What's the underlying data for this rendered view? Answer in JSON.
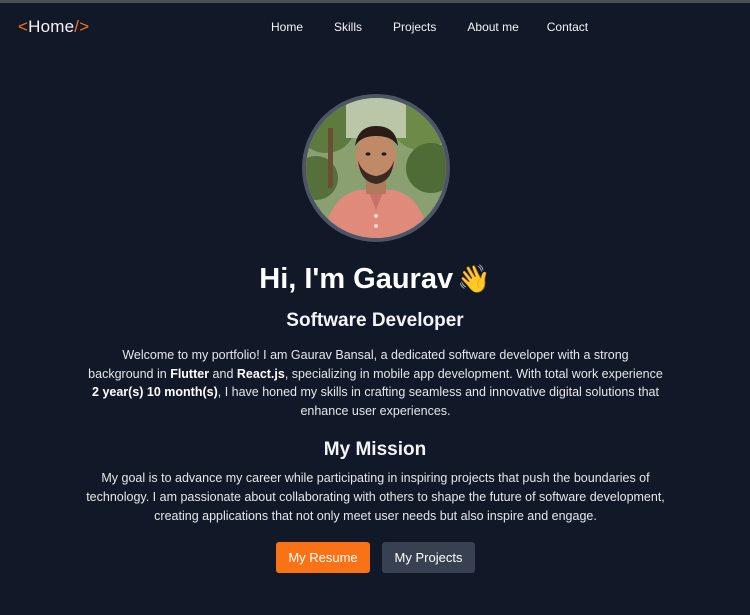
{
  "nav": {
    "logo_open": "<",
    "logo_text": "Home",
    "logo_close": "/>",
    "links": [
      "Home",
      "Skills",
      "Projects",
      "About me",
      "Contact"
    ]
  },
  "hero": {
    "avatar_icon": "profile-photo",
    "greeting": "Hi, I'm Gaurav",
    "wave_emoji": "👋",
    "role": "Software Developer",
    "intro": {
      "part1": "Welcome to my portfolio! I am Gaurav Bansal, a dedicated software developer with a strong background in ",
      "bold1": "Flutter",
      "part2": " and ",
      "bold2": "React.js",
      "part3": ", specializing in mobile app development. With total work experience ",
      "bold3": "2 year(s) 10 month(s)",
      "part4": ", I have honed my skills in crafting seamless and innovative digital solutions that enhance user experiences."
    }
  },
  "mission": {
    "title": "My Mission",
    "text": "My goal is to advance my career while participating in inspiring projects that push the boundaries of technology. I am passionate about collaborating with others to shape the future of software development, creating applications that not only meet user needs but also inspire and engage."
  },
  "buttons": {
    "resume": "My Resume",
    "projects": "My Projects"
  },
  "colors": {
    "background": "#111827",
    "accent": "#f97316",
    "secondary_button": "#374151"
  }
}
